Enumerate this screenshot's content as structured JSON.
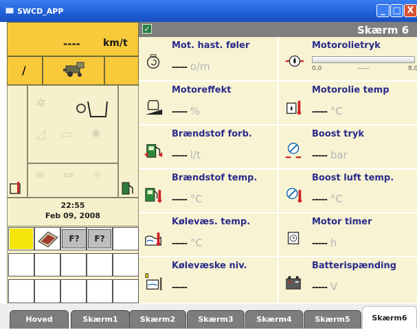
{
  "window": {
    "title": "SWCD_APP",
    "minimize": "_",
    "maximize": "□",
    "close": "X"
  },
  "left": {
    "speed_value": "----",
    "speed_unit": "km/t",
    "gear": "/",
    "time": "22:55",
    "date": "Feb 09, 2008"
  },
  "screen": {
    "title": "Skærm 6"
  },
  "metrics": [
    {
      "label": "Mot. hast. føler",
      "value": "-----",
      "unit": "o/m",
      "icon": "fan-icon"
    },
    {
      "label": "Motorolietryk",
      "gauge_min": "0,0",
      "gauge_mid": "-----",
      "gauge_max": "8,0",
      "icon": "oil-pressure-icon"
    },
    {
      "label": "Motoreffekt",
      "value": "-----",
      "unit": "%",
      "icon": "engine-power-icon"
    },
    {
      "label": "Motorolie temp",
      "value": "-----",
      "unit": "°C",
      "icon": "oil-temp-icon"
    },
    {
      "label": "Brændstof forb.",
      "value": "-----",
      "unit": "l/t",
      "icon": "fuel-consumption-icon"
    },
    {
      "label": "Boost tryk",
      "value": "-----",
      "unit": "bar",
      "icon": "turbo-boost-icon"
    },
    {
      "label": "Brændstof temp.",
      "value": "-----",
      "unit": "°C",
      "icon": "fuel-temp-icon"
    },
    {
      "label": "Boost luft temp.",
      "value": "-----",
      "unit": "°C",
      "icon": "boost-air-temp-icon"
    },
    {
      "label": "Kølevæs. temp.",
      "value": "-----",
      "unit": "°C",
      "icon": "coolant-temp-icon"
    },
    {
      "label": "Motor timer",
      "value": "-----",
      "unit": "h",
      "icon": "engine-hours-icon"
    },
    {
      "label": "Kølevæske niv.",
      "value": "-----",
      "unit": "",
      "icon": "coolant-level-icon"
    },
    {
      "label": "Batterispænding",
      "value": "-----",
      "unit": "V",
      "icon": "battery-icon"
    }
  ],
  "tabs": [
    "Hoved",
    "Skærm1",
    "Skærm2",
    "Skærm3",
    "Skærm4",
    "Skærm5",
    "Skærm6"
  ],
  "grid": {
    "cell_text": [
      "F?",
      "F?"
    ]
  },
  "colors": {
    "accent_yellow": "#f8c93a",
    "panel": "#f7f3d3",
    "label_blue": "#2a2a8a",
    "titlebar_blue": "#1f5fd6"
  }
}
